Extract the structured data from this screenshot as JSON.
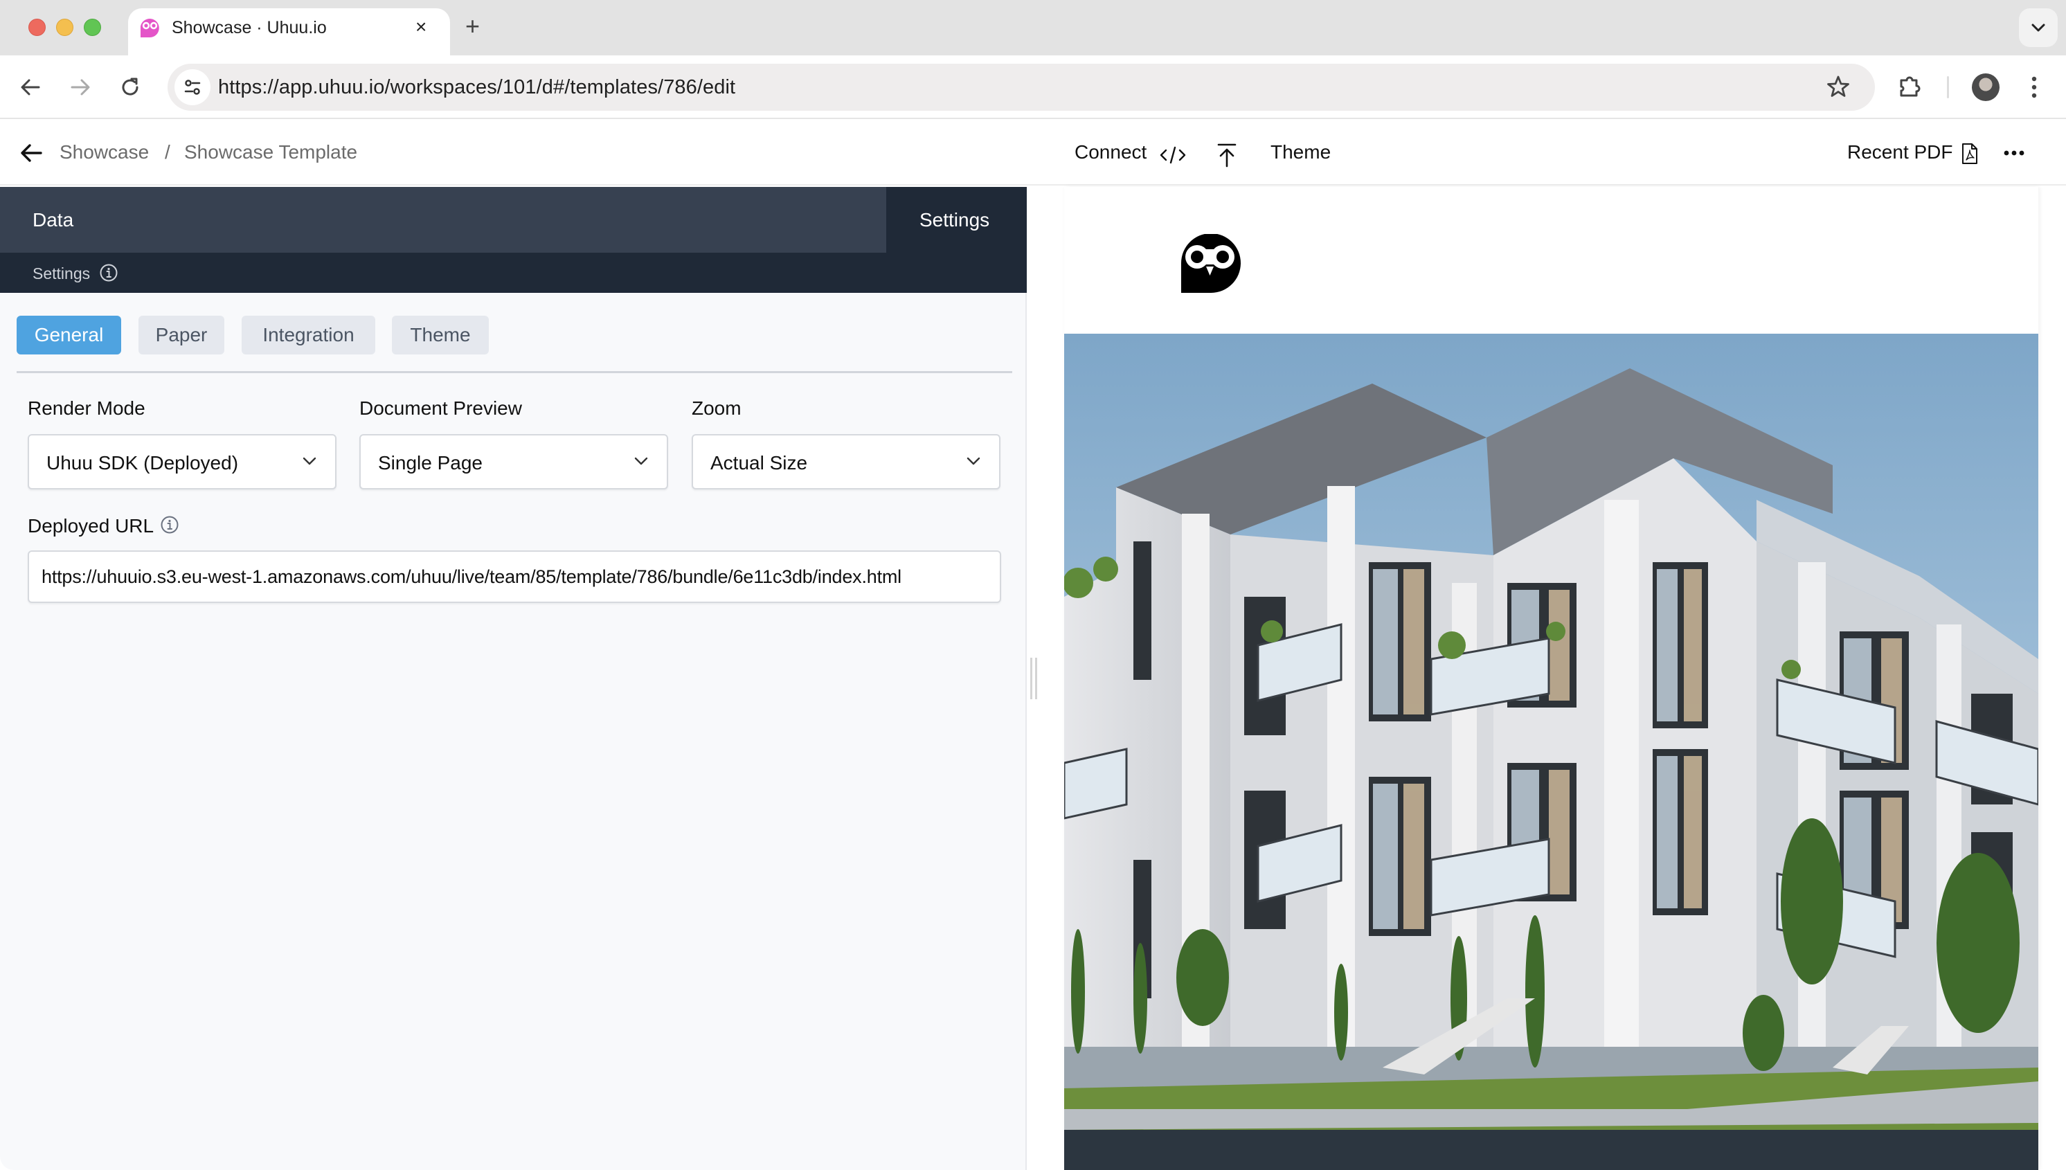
{
  "browser": {
    "tab_title": "Showcase · Uhuu.io",
    "tab_close": "×",
    "new_tab": "+",
    "url": "https://app.uhuu.io/workspaces/101/d#/templates/786/edit",
    "icons": {
      "favicon": "uhuu-owl-icon",
      "back": "arrow-left-icon",
      "forward": "arrow-right-icon",
      "reload": "reload-icon",
      "site_info": "tune-icon",
      "bookmark": "star-icon",
      "extensions": "puzzle-icon",
      "profile": "avatar",
      "menu": "kebab-icon",
      "tab_search": "chevron-down-icon"
    }
  },
  "header": {
    "breadcrumb": [
      "Showcase",
      "Showcase Template"
    ],
    "breadcrumb_separator": "/",
    "connect_label": "Connect",
    "theme_label": "Theme",
    "recent_pdf_label": "Recent PDF",
    "icons": {
      "back": "arrow-left-icon",
      "connect": "code-icon",
      "publish": "upload-icon",
      "pdf": "pdf-file-icon",
      "more": "more-horizontal-icon"
    }
  },
  "panel": {
    "tabs": [
      {
        "label": "Data",
        "active": false
      },
      {
        "label": "Settings",
        "active": true
      }
    ],
    "section_title": "Settings",
    "subtabs": [
      {
        "label": "General",
        "active": true
      },
      {
        "label": "Paper",
        "active": false
      },
      {
        "label": "Integration",
        "active": false
      },
      {
        "label": "Theme",
        "active": false
      }
    ],
    "fields": {
      "render_mode": {
        "label": "Render Mode",
        "value": "Uhuu SDK (Deployed)"
      },
      "document_preview": {
        "label": "Document Preview",
        "value": "Single Page"
      },
      "zoom": {
        "label": "Zoom",
        "value": "Actual Size"
      },
      "deployed_url": {
        "label": "Deployed URL",
        "value": "https://uhuuio.s3.eu-west-1.amazonaws.com/uhuu/live/team/85/template/786/bundle/6e11c3db/index.html"
      }
    }
  },
  "colors": {
    "accent": "#4fa3e0",
    "panel_dark": "#1f2937",
    "panel_tab": "#374151",
    "favicon": "#e455c8"
  },
  "preview": {
    "logo": "uhuu-owl-logo",
    "hero_image": "modern-apartment-building-photo"
  }
}
